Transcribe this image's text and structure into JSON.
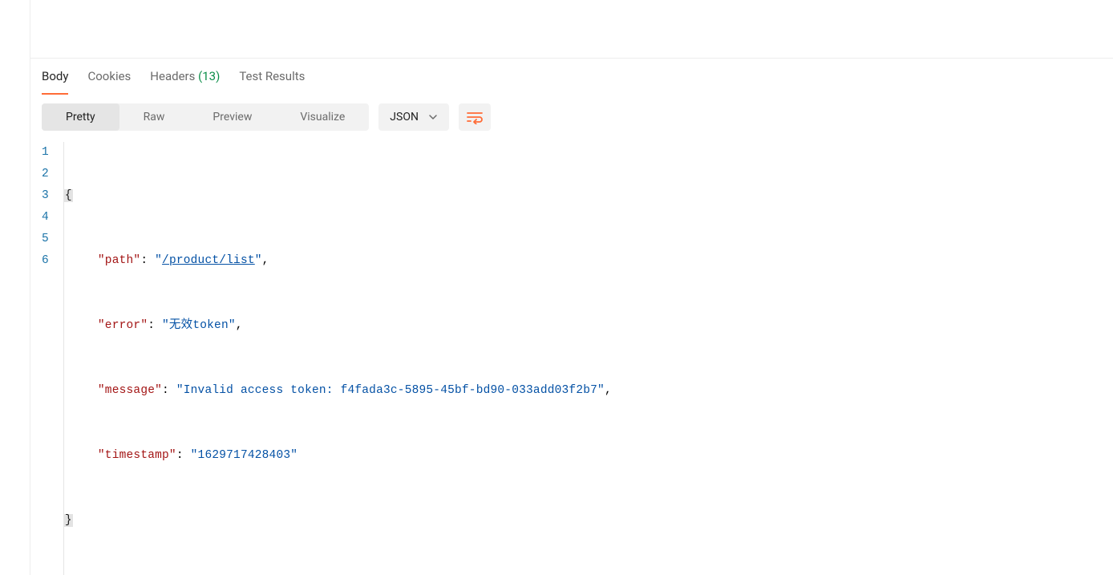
{
  "tabs": {
    "body": "Body",
    "cookies": "Cookies",
    "headers": "Headers",
    "headers_count": "(13)",
    "test_results": "Test Results"
  },
  "view_modes": {
    "pretty": "Pretty",
    "raw": "Raw",
    "preview": "Preview",
    "visualize": "Visualize"
  },
  "format_select": {
    "value": "JSON"
  },
  "response": {
    "lines": [
      "1",
      "2",
      "3",
      "4",
      "5",
      "6"
    ],
    "path_key": "\"path\"",
    "path_val": "/product/list",
    "error_key": "\"error\"",
    "error_val": "\"无效token\"",
    "message_key": "\"message\"",
    "message_val": "\"Invalid access token: f4fada3c-5895-45bf-bd90-033add03f2b7\"",
    "timestamp_key": "\"timestamp\"",
    "timestamp_val": "\"1629717428403\""
  }
}
